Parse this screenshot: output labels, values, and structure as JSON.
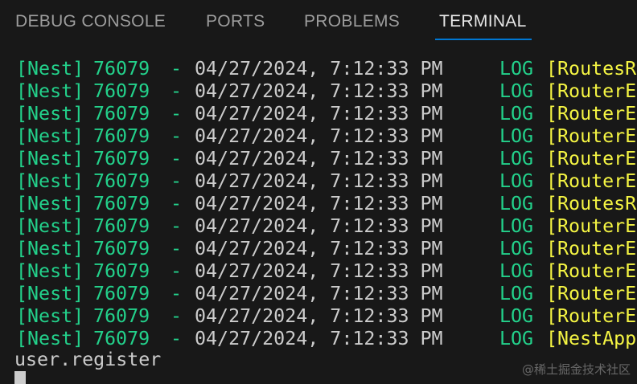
{
  "tabs": [
    {
      "label": "DEBUG CONSOLE",
      "active": false
    },
    {
      "label": "PORTS",
      "active": false
    },
    {
      "label": "PROBLEMS",
      "active": false
    },
    {
      "label": "TERMINAL",
      "active": true
    }
  ],
  "terminal": {
    "log_lines": [
      {
        "prefix": "[Nest]",
        "pid": "76079",
        "dash": "-",
        "timestamp": "04/27/2024, 7:12:33 PM",
        "level": "LOG",
        "context": "[RoutesRe"
      },
      {
        "prefix": "[Nest]",
        "pid": "76079",
        "dash": "-",
        "timestamp": "04/27/2024, 7:12:33 PM",
        "level": "LOG",
        "context": "[RouterEx"
      },
      {
        "prefix": "[Nest]",
        "pid": "76079",
        "dash": "-",
        "timestamp": "04/27/2024, 7:12:33 PM",
        "level": "LOG",
        "context": "[RouterEx"
      },
      {
        "prefix": "[Nest]",
        "pid": "76079",
        "dash": "-",
        "timestamp": "04/27/2024, 7:12:33 PM",
        "level": "LOG",
        "context": "[RouterEx"
      },
      {
        "prefix": "[Nest]",
        "pid": "76079",
        "dash": "-",
        "timestamp": "04/27/2024, 7:12:33 PM",
        "level": "LOG",
        "context": "[RouterEx"
      },
      {
        "prefix": "[Nest]",
        "pid": "76079",
        "dash": "-",
        "timestamp": "04/27/2024, 7:12:33 PM",
        "level": "LOG",
        "context": "[RouterEx"
      },
      {
        "prefix": "[Nest]",
        "pid": "76079",
        "dash": "-",
        "timestamp": "04/27/2024, 7:12:33 PM",
        "level": "LOG",
        "context": "[RoutesRe"
      },
      {
        "prefix": "[Nest]",
        "pid": "76079",
        "dash": "-",
        "timestamp": "04/27/2024, 7:12:33 PM",
        "level": "LOG",
        "context": "[RouterEx"
      },
      {
        "prefix": "[Nest]",
        "pid": "76079",
        "dash": "-",
        "timestamp": "04/27/2024, 7:12:33 PM",
        "level": "LOG",
        "context": "[RouterEx"
      },
      {
        "prefix": "[Nest]",
        "pid": "76079",
        "dash": "-",
        "timestamp": "04/27/2024, 7:12:33 PM",
        "level": "LOG",
        "context": "[RouterEx"
      },
      {
        "prefix": "[Nest]",
        "pid": "76079",
        "dash": "-",
        "timestamp": "04/27/2024, 7:12:33 PM",
        "level": "LOG",
        "context": "[RouterEx"
      },
      {
        "prefix": "[Nest]",
        "pid": "76079",
        "dash": "-",
        "timestamp": "04/27/2024, 7:12:33 PM",
        "level": "LOG",
        "context": "[RouterEx"
      },
      {
        "prefix": "[Nest]",
        "pid": "76079",
        "dash": "-",
        "timestamp": "04/27/2024, 7:12:33 PM",
        "level": "LOG",
        "context": "[NestApp"
      }
    ],
    "output_line": "user.register"
  },
  "watermark": "@稀土掘金技术社区",
  "colors": {
    "background": "#181818",
    "green": "#23d18b",
    "yellow": "#f5f543",
    "text": "#cccccc",
    "active_tab_underline": "#0078d4"
  }
}
